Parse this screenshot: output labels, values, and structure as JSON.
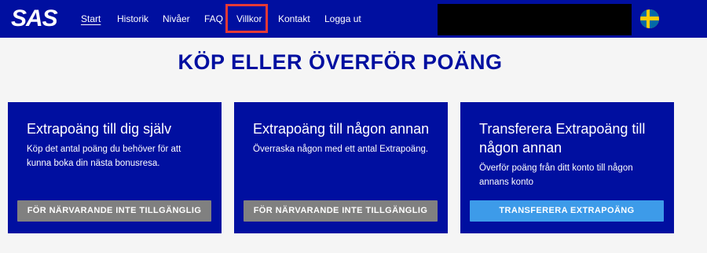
{
  "header": {
    "logo": "SAS",
    "nav": [
      {
        "label": "Start",
        "active": true
      },
      {
        "label": "Historik",
        "active": false
      },
      {
        "label": "Nivåer",
        "active": false
      },
      {
        "label": "FAQ",
        "active": false
      },
      {
        "label": "Villkor",
        "active": false,
        "highlighted": true
      },
      {
        "label": "Kontakt",
        "active": false
      },
      {
        "label": "Logga ut",
        "active": false
      }
    ],
    "language_flag_icon": "sweden-flag-icon"
  },
  "page": {
    "title": "KÖP ELLER ÖVERFÖR POÄNG"
  },
  "cards": [
    {
      "title": "Extrapoäng till dig själv",
      "description": "Köp det antal poäng du behöver för att kunna boka din nästa bonusresa.",
      "button": "FÖR NÄRVARANDE INTE TILLGÄNGLIG",
      "button_state": "disabled"
    },
    {
      "title": "Extrapoäng till någon annan",
      "description": "Överraska någon med ett antal Extrapoäng.",
      "button": "FÖR NÄRVARANDE INTE TILLGÄNGLIG",
      "button_state": "disabled"
    },
    {
      "title": "Transferera Extrapoäng till någon annan",
      "description": "Överför poäng från ditt konto till någon annans konto",
      "button": "TRANSFERERA EXTRAPOÄNG",
      "button_state": "enabled"
    }
  ],
  "colors": {
    "brand_blue": "#000fa0",
    "button_disabled": "#808080",
    "button_primary": "#3d9be9",
    "highlight_red": "#e53935"
  }
}
